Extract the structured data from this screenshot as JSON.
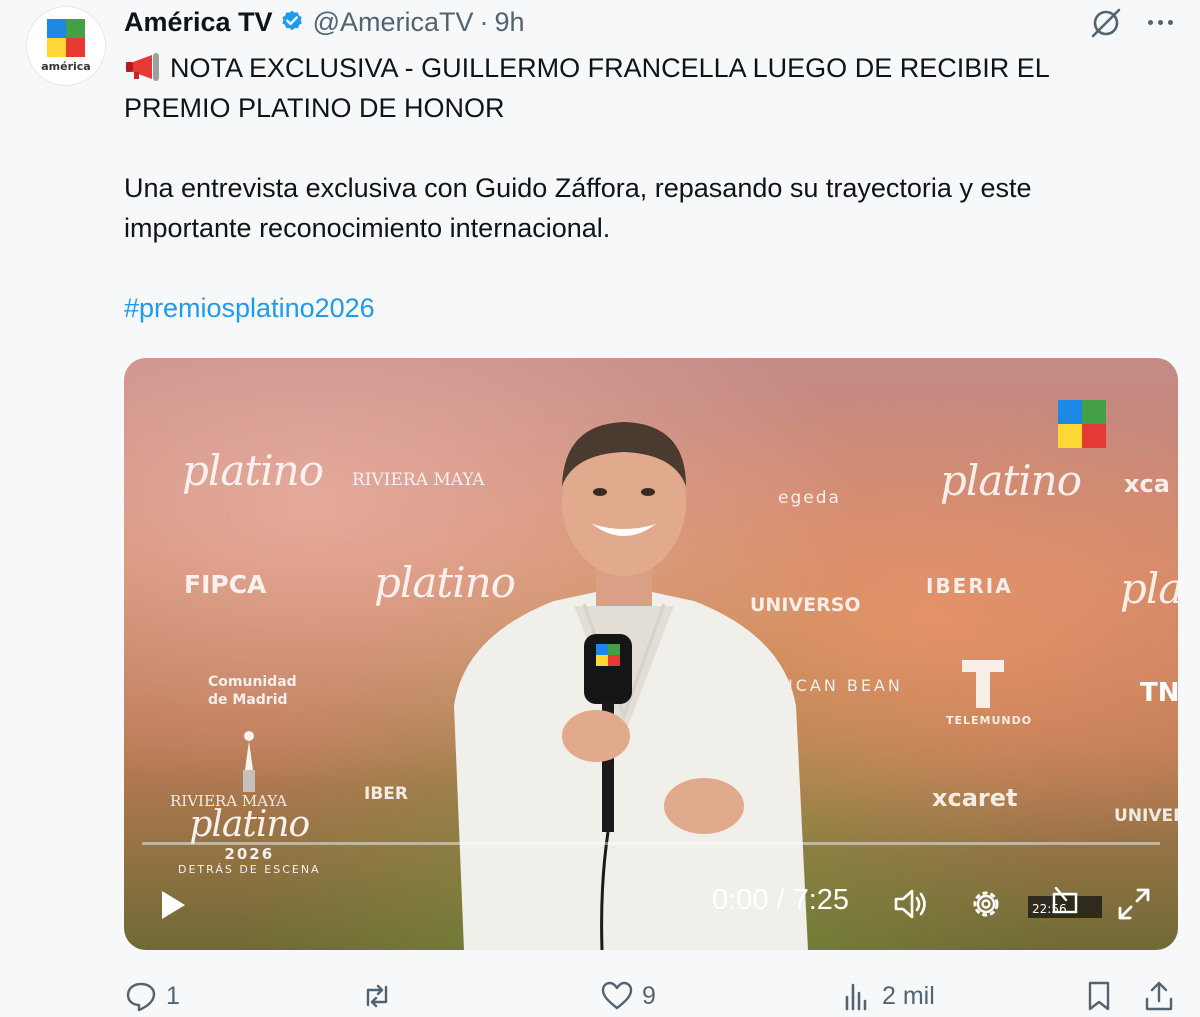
{
  "tweet": {
    "display_name": "América TV",
    "handle": "@AmericaTV",
    "separator": "·",
    "time": "9h",
    "avatar_label": "américa",
    "lines": [
      "NOTA EXCLUSIVA - GUILLERMO FRANCELLA LUEGO DE RECIBIR EL",
      "PREMIO PLATINO DE HONOR",
      "Una entrevista exclusiva con Guido Záffora, repasando su trayectoria y este",
      "importante reconocimiento internacional."
    ],
    "hashtag": "#premiosplatino2026"
  },
  "video": {
    "time_display": "0:00 / 7:25",
    "progress_fraction": 0.0,
    "background_logos": {
      "platino": "platino",
      "riviera_maya": "RIVIERA MAYA",
      "egeda": "egeda",
      "xcaret_short": "xca",
      "fipca": "FIPCA",
      "universo": "UNIVERSO",
      "iberia": "IBERIA",
      "comunidad": "Comunidad",
      "de_madrid": "de Madrid",
      "telemundo": "TELEMUNDO",
      "xcaret": "xcaret",
      "tn": "TN",
      "iber": "IBER",
      "caribbean": "ICAN BEAN",
      "univer": "UNIVER"
    },
    "mic_label": "américa",
    "bottom_logo": {
      "script": "platino",
      "year": "2026",
      "subtitle": "DETRÁS DE ESCENA"
    },
    "subtitle_badge": "22:56"
  },
  "actions": {
    "replies": "1",
    "reposts": "",
    "likes": "9",
    "views": "2 mil"
  },
  "colors": {
    "link": "#1d9bf0",
    "muted": "#536471",
    "verified": "#1d9bf0"
  }
}
